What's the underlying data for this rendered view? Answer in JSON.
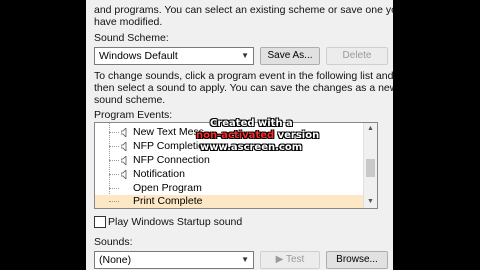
{
  "intro": {
    "line1": "and programs.  You can select an existing scheme or save one you",
    "line2": "have modified."
  },
  "scheme": {
    "label": "Sound Scheme:",
    "selected": "Windows Default",
    "save_as": "Save As...",
    "delete": "Delete"
  },
  "instructions": {
    "line1": "To change sounds, click a program event in the following list and",
    "line2": "then select a sound to apply.  You can save the changes as a new",
    "line3": "sound scheme."
  },
  "events": {
    "label": "Program Events:",
    "items": [
      {
        "label": "New Text Mess",
        "icon": "speaker-icon"
      },
      {
        "label": "NFP Completion",
        "icon": "speaker-icon"
      },
      {
        "label": "NFP Connection",
        "icon": "speaker-icon"
      },
      {
        "label": "Notification",
        "icon": "speaker-icon"
      },
      {
        "label": "Open Program",
        "icon": ""
      },
      {
        "label": "Print Complete",
        "icon": ""
      }
    ],
    "selected_index": 5
  },
  "startup": {
    "label": "Play Windows Startup sound",
    "checked": false
  },
  "sounds": {
    "label": "Sounds:",
    "selected": "(None)",
    "test": "Test",
    "browse": "Browse..."
  },
  "watermark": {
    "line1": "Created with a",
    "line2_red": "non-activated",
    "line2_rest": " version",
    "line3": "www.ascreen.com"
  }
}
